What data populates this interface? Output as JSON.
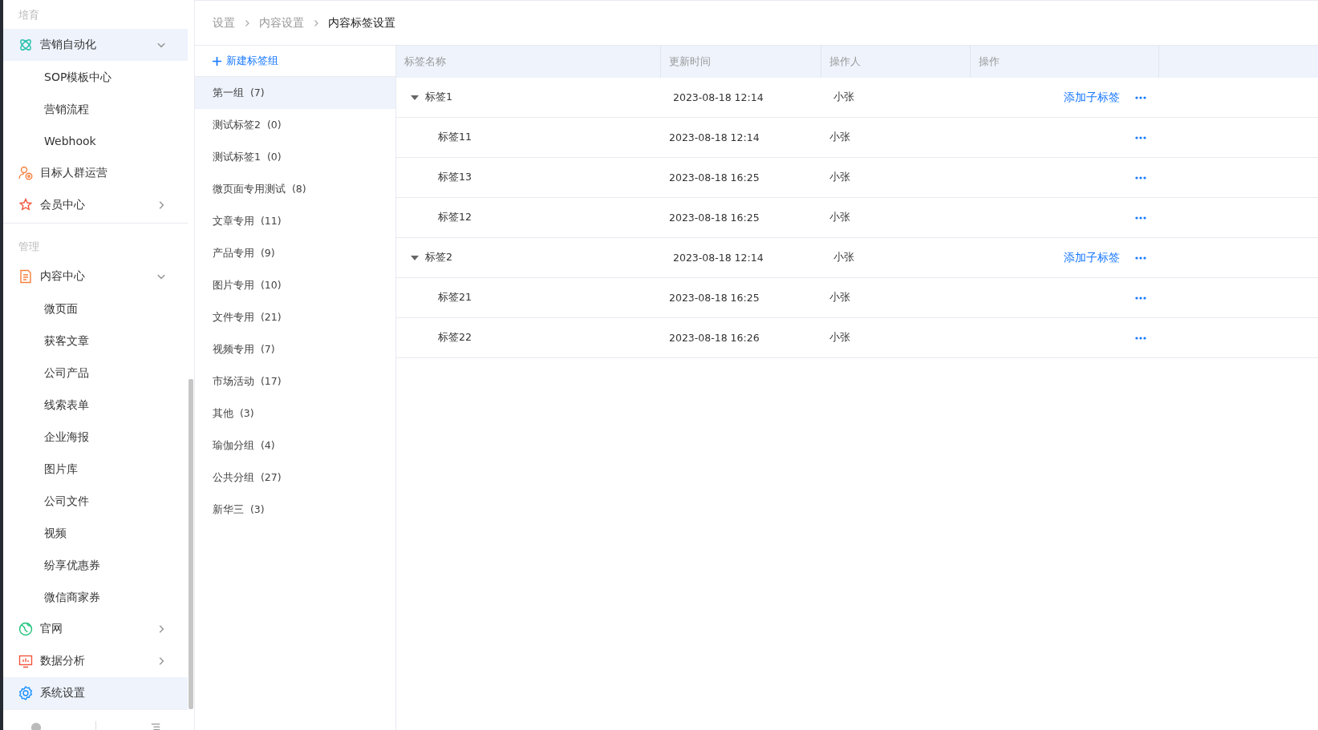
{
  "sidebar": {
    "sections": [
      {
        "label": "培育",
        "items": [
          {
            "kind": "atom",
            "label": "营销自动化",
            "selected": true,
            "expanded": true,
            "children": [
              {
                "label": "SOP模板中心",
                "selected": false
              },
              {
                "label": "营销流程",
                "selected": false
              },
              {
                "label": "Webhook",
                "selected": false
              }
            ]
          },
          {
            "kind": "target-person",
            "label": "目标人群运营",
            "selected": false
          },
          {
            "kind": "star",
            "label": "会员中心",
            "selected": false,
            "expanded": false
          }
        ]
      },
      {
        "label": "管理",
        "items": [
          {
            "kind": "document",
            "label": "内容中心",
            "selected": false,
            "expanded": true,
            "children": [
              {
                "label": "微页面",
                "selected": false
              },
              {
                "label": "获客文章",
                "selected": false
              },
              {
                "label": "公司产品",
                "selected": false
              },
              {
                "label": "线索表单",
                "selected": false
              },
              {
                "label": "企业海报",
                "selected": false
              },
              {
                "label": "图片库",
                "selected": false
              },
              {
                "label": "公司文件",
                "selected": false
              },
              {
                "label": "视频",
                "selected": false
              },
              {
                "label": "纷享优惠券",
                "selected": false
              },
              {
                "label": "微信商家券",
                "selected": false
              }
            ]
          },
          {
            "kind": "globe",
            "label": "官网",
            "selected": false,
            "expanded": false
          },
          {
            "kind": "monitor",
            "label": "数据分析",
            "selected": false,
            "expanded": false
          },
          {
            "kind": "gear",
            "label": "系统设置",
            "selected": true
          }
        ]
      }
    ]
  },
  "breadcrumb": [
    "设置",
    "内容设置",
    "内容标签设置"
  ],
  "new_group_button": "新建标签组",
  "groups": [
    {
      "name": "第一组",
      "count": "(7)",
      "selected": true
    },
    {
      "name": "测试标签2",
      "count": "(0)",
      "selected": false
    },
    {
      "name": "测试标签1",
      "count": "(0)",
      "selected": false
    },
    {
      "name": "微页面专用测试",
      "count": "(8)",
      "selected": false
    },
    {
      "name": "文章专用",
      "count": "(11)",
      "selected": false
    },
    {
      "name": "产品专用",
      "count": "(9)",
      "selected": false
    },
    {
      "name": "图片专用",
      "count": "(10)",
      "selected": false
    },
    {
      "name": "文件专用",
      "count": "(21)",
      "selected": false
    },
    {
      "name": "视频专用",
      "count": "(7)",
      "selected": false
    },
    {
      "name": "市场活动",
      "count": "(17)",
      "selected": false
    },
    {
      "name": "其他",
      "count": "(3)",
      "selected": false
    },
    {
      "name": "瑜伽分组",
      "count": "(4)",
      "selected": false
    },
    {
      "name": "公共分组",
      "count": "(27)",
      "selected": false
    },
    {
      "name": "新华三",
      "count": "(3)",
      "selected": false
    }
  ],
  "table": {
    "columns": [
      "标签名称",
      "更新时间",
      "操作人",
      "操作"
    ],
    "rows": [
      {
        "name": "标签1",
        "updated": "2023-08-18 12:14",
        "operator": "小张",
        "action": "添加子标签",
        "expanded": true,
        "children": [
          {
            "name": "标签11",
            "updated": "2023-08-18 12:14",
            "operator": "小张"
          },
          {
            "name": "标签13",
            "updated": "2023-08-18 16:25",
            "operator": "小张"
          },
          {
            "name": "标签12",
            "updated": "2023-08-18 16:25",
            "operator": "小张"
          }
        ]
      },
      {
        "name": "标签2",
        "updated": "2023-08-18 12:14",
        "operator": "小张",
        "action": "添加子标签",
        "expanded": true,
        "children": [
          {
            "name": "标签21",
            "updated": "2023-08-18 16:25",
            "operator": "小张"
          },
          {
            "name": "标签22",
            "updated": "2023-08-18 16:26",
            "operator": "小张"
          }
        ]
      }
    ]
  }
}
